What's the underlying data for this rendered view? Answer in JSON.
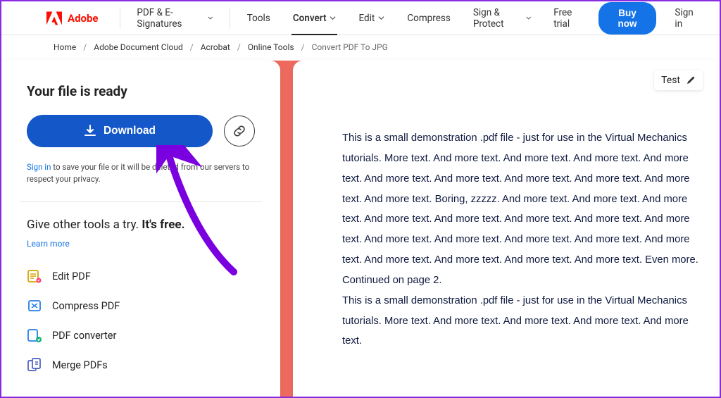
{
  "brand": "Adobe",
  "nav": {
    "pdf_esign": "PDF & E-Signatures",
    "tools": "Tools",
    "convert": "Convert",
    "edit": "Edit",
    "compress": "Compress",
    "sign_protect": "Sign & Protect",
    "free_trial": "Free trial",
    "buy_now": "Buy now",
    "sign_in_top": "Sign in"
  },
  "breadcrumb": {
    "home": "Home",
    "doc_cloud": "Adobe Document Cloud",
    "acrobat": "Acrobat",
    "online_tools": "Online Tools",
    "current": "Convert PDF To JPG"
  },
  "left": {
    "heading": "Your file is ready",
    "download": "Download",
    "signin_link": "Sign in",
    "note_rest": " to save your file or it will be deleted from our servers to respect your privacy.",
    "promo_a": "Give other tools a try. ",
    "promo_b": "It's free.",
    "learn_more": "Learn more",
    "tools": {
      "edit": "Edit PDF",
      "compress": "Compress PDF",
      "converter": "PDF converter",
      "merge": "Merge PDFs"
    }
  },
  "right": {
    "file_label": "Test",
    "block1": "This is a small demonstration .pdf file - just for use in the Virtual Mechanics tutorials. More text. And more text. And more text. And more text. And more text. And more text. And more text. And more text. And more text. And more text. And more text. Boring, zzzzz. And more text. And more text. And more text. And more text. And more text. And more text. And more text. And more text. And more text. And more text. And more text. And more text. And more text. And more text. And more text. And more text. And more text. Even more. Continued on page 2.",
    "block2": "This is a small demonstration .pdf file - just for use in the Virtual Mechanics tutorials. More text. And more text. And more text. And more text. And more text."
  }
}
